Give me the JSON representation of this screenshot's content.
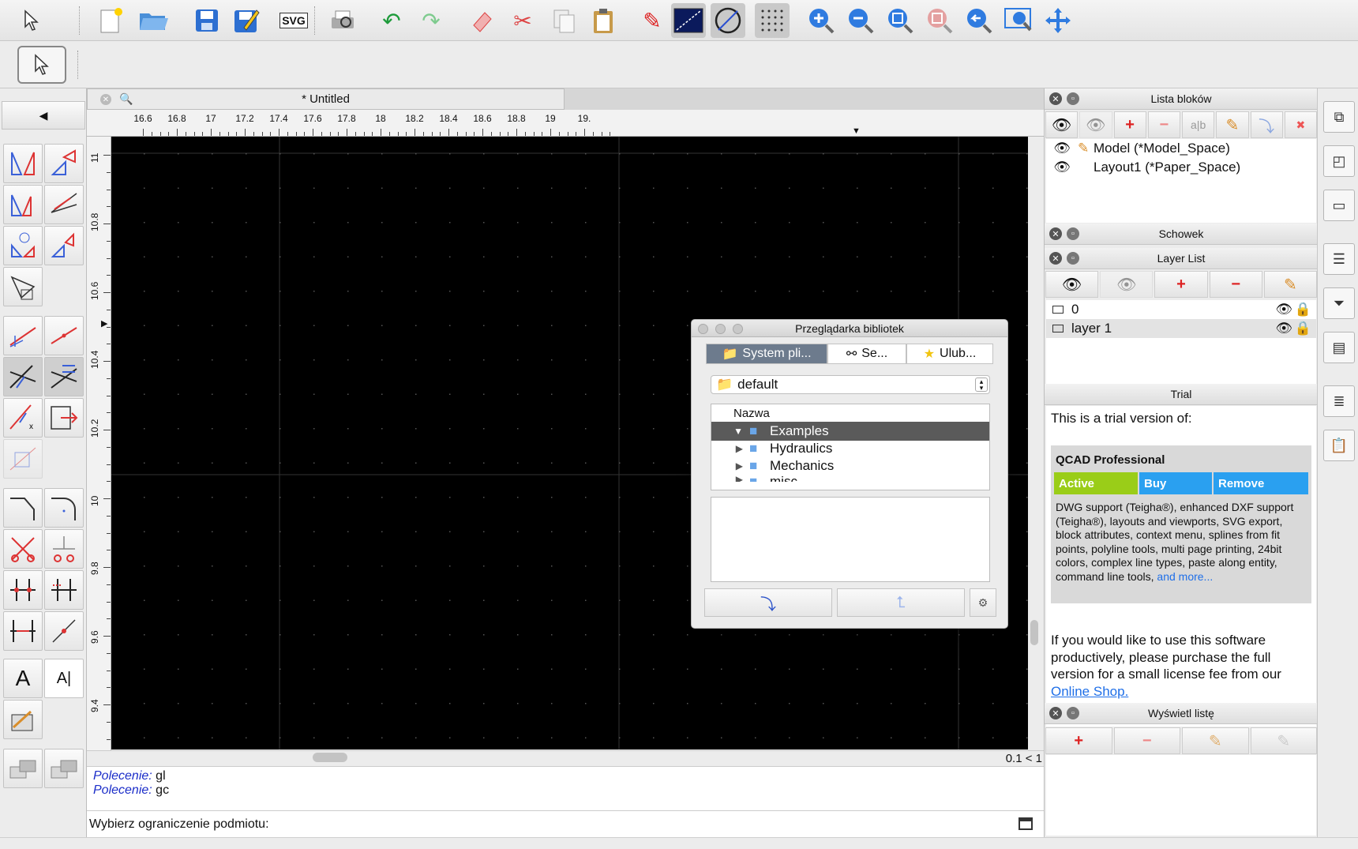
{
  "toolbar": {
    "items": [
      "pointer-icon",
      "new-file-icon",
      "open-folder-icon",
      "save-icon",
      "save-as-icon",
      "svg-export-icon",
      "print-preview-icon",
      "undo-icon",
      "redo-icon",
      "eraser-icon",
      "scissors-icon",
      "copy-icon",
      "paste-icon",
      "pencil-icon",
      "grid-display-icon",
      "snap-circle-icon",
      "dot-grid-icon",
      "zoom-in-icon",
      "zoom-out-icon",
      "zoom-auto-icon",
      "zoom-selection-icon",
      "zoom-previous-icon",
      "zoom-window-icon",
      "pan-icon"
    ],
    "svg_label": "SVG"
  },
  "document": {
    "tab_title": "* Untitled"
  },
  "ruler": {
    "h_labels": [
      "16.6",
      "16.8",
      "17",
      "17.2",
      "17.4",
      "17.6",
      "17.8",
      "18",
      "18.2",
      "18.4",
      "18.6",
      "18.8",
      "19",
      "19."
    ],
    "v_labels": [
      "11",
      "10.8",
      "10.6",
      "10.4",
      "10.2",
      "10",
      "9.8",
      "9.6",
      "9.4"
    ]
  },
  "canvas": {
    "zoom_readout": "0.1 < 1"
  },
  "command": {
    "history": [
      {
        "prompt": "Polecenie:",
        "cmd": "gl"
      },
      {
        "prompt": "Polecenie:",
        "cmd": "gc"
      }
    ],
    "input_prompt": "Wybierz ograniczenie podmiotu:"
  },
  "block_list": {
    "title": "Lista bloków",
    "items": [
      "Model (*Model_Space)",
      "Layout1 (*Paper_Space)"
    ]
  },
  "clipboard": {
    "title": "Schowek"
  },
  "layer_list": {
    "title": "Layer List",
    "layers": [
      "0",
      "layer 1"
    ]
  },
  "trial": {
    "title": "Trial",
    "intro": "This is a trial version of:",
    "product": "QCAD Professional",
    "tags": [
      "Active",
      "Buy",
      "Remove"
    ],
    "description": "DWG support (Teigha®), enhanced DXF support (Teigha®), layouts and viewports, SVG export, block attributes, context menu, splines from fit points, polyline tools, multi page printing, 24bit colors, complex line types, paste along entity, command line tools,",
    "more_link": "and more...",
    "purchase_text": "If you would like to use this software productively, please purchase the full version for a small license fee from our",
    "shop_link": "Online Shop."
  },
  "list_view": {
    "title": "Wyświetl listę"
  },
  "library": {
    "title": "Przeglądarka bibliotek",
    "tabs": [
      "System pli...",
      "Se...",
      "Ulub..."
    ],
    "combo_value": "default",
    "column": "Nazwa",
    "tree": [
      "Examples",
      "Hydraulics",
      "Mechanics",
      "misc"
    ]
  },
  "colors": {
    "canvas_bg": "#000000",
    "accent_blue": "#2aa0f0",
    "active_green": "#9acd18",
    "command_blue": "#1c2ec9"
  }
}
